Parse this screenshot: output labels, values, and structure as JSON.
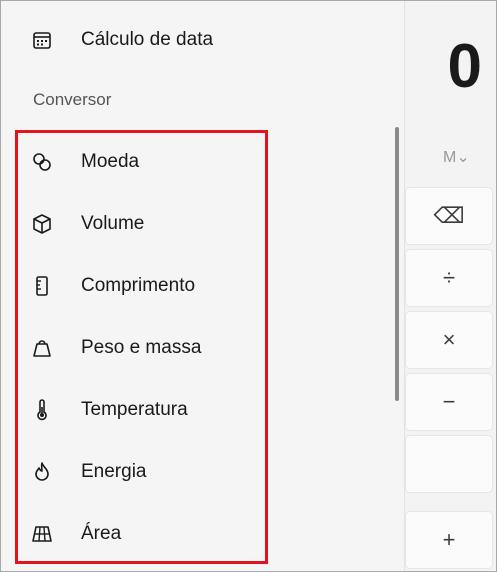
{
  "calculator": {
    "display_value": "0",
    "memory_label": "M⌄",
    "keys": [
      {
        "name": "backspace",
        "glyph": "⌫"
      },
      {
        "name": "divide",
        "glyph": "÷"
      },
      {
        "name": "multiply",
        "glyph": "×"
      },
      {
        "name": "subtract",
        "glyph": "−"
      },
      {
        "name": "add",
        "glyph": "+"
      }
    ]
  },
  "nav": {
    "top_item": {
      "label": "Cálculo de data",
      "icon": "calendar-icon"
    },
    "section_header": "Conversor",
    "items": [
      {
        "label": "Moeda",
        "icon": "currency-icon"
      },
      {
        "label": "Volume",
        "icon": "cube-icon"
      },
      {
        "label": "Comprimento",
        "icon": "ruler-icon"
      },
      {
        "label": "Peso e massa",
        "icon": "weight-icon"
      },
      {
        "label": "Temperatura",
        "icon": "thermometer-icon"
      },
      {
        "label": "Energia",
        "icon": "flame-icon"
      },
      {
        "label": "Área",
        "icon": "area-grid-icon"
      }
    ]
  },
  "colors": {
    "highlight": "#e3131b",
    "nav_background": "#f5f5f5",
    "calc_background": "#f3f3f3"
  }
}
